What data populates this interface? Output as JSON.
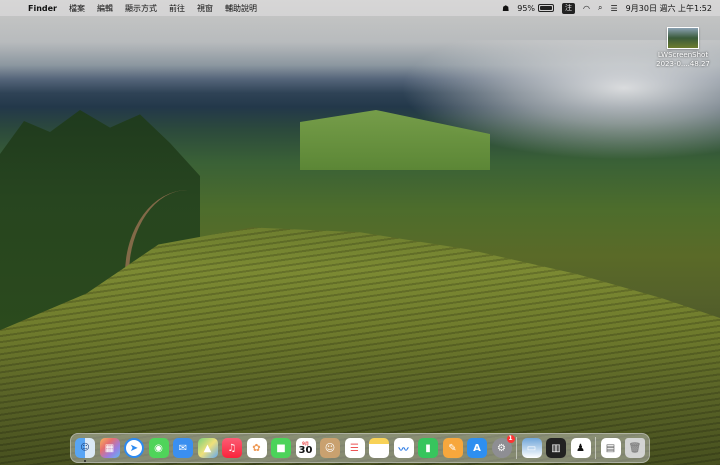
{
  "menubar": {
    "apple": "",
    "items": [
      "Finder",
      "檔案",
      "編輯",
      "顯示方式",
      "前往",
      "視窗",
      "輔助說明"
    ],
    "battery_percent": "95%",
    "ime": "注",
    "datetime": "9月30日 週六 上午1:52"
  },
  "desktop_file": {
    "name_line1": "LWScreenShot",
    "name_line2": "2023-0....48.27"
  },
  "dock": {
    "calendar_month": "9月",
    "calendar_day": "30",
    "settings_badge": "1"
  }
}
